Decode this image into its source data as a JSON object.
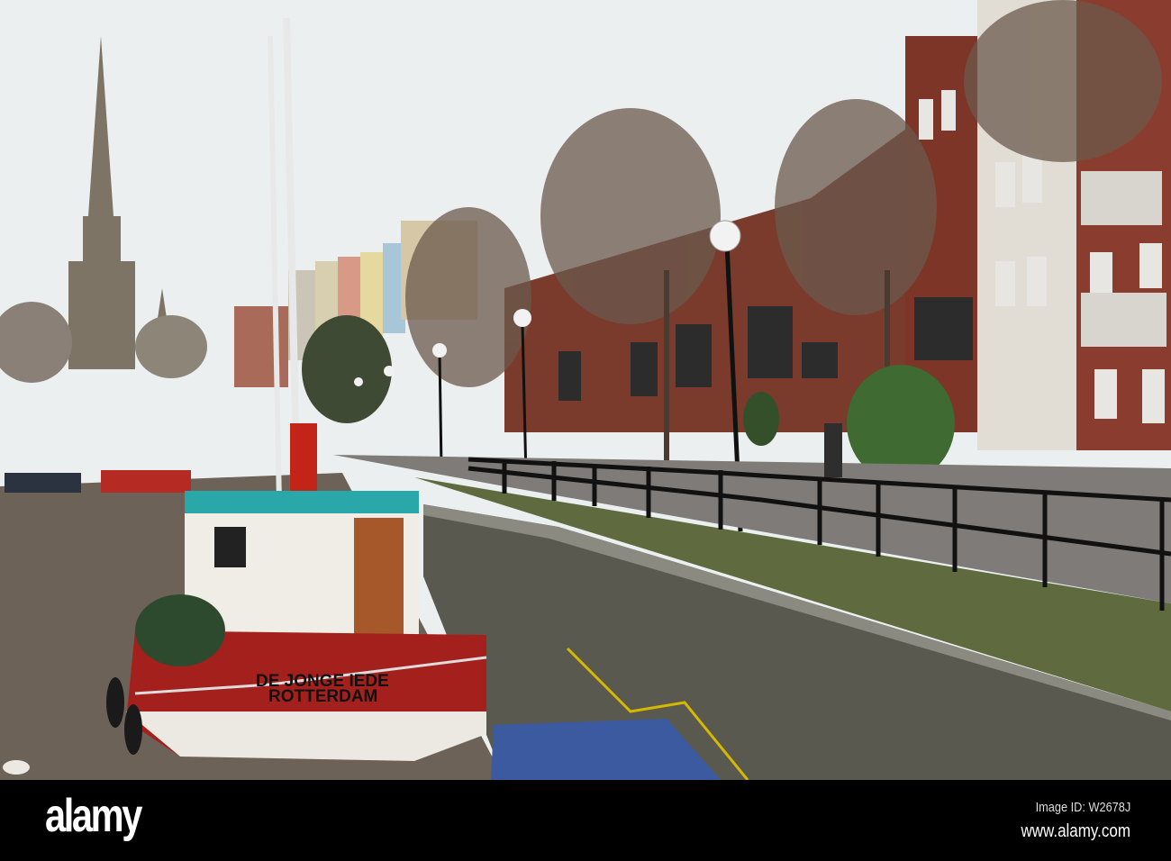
{
  "photo": {
    "boat_name": "DE JONGE IEDE",
    "boat_port": "ROTTERDAM"
  },
  "watermark": {
    "logo": "alamy",
    "image_id": "Image ID: W2678J",
    "url": "www.alamy.com"
  },
  "colors": {
    "sky": "#eceff0",
    "hull": "#a3201c",
    "water": "#6d6258",
    "brick": "#7a3a2c"
  }
}
